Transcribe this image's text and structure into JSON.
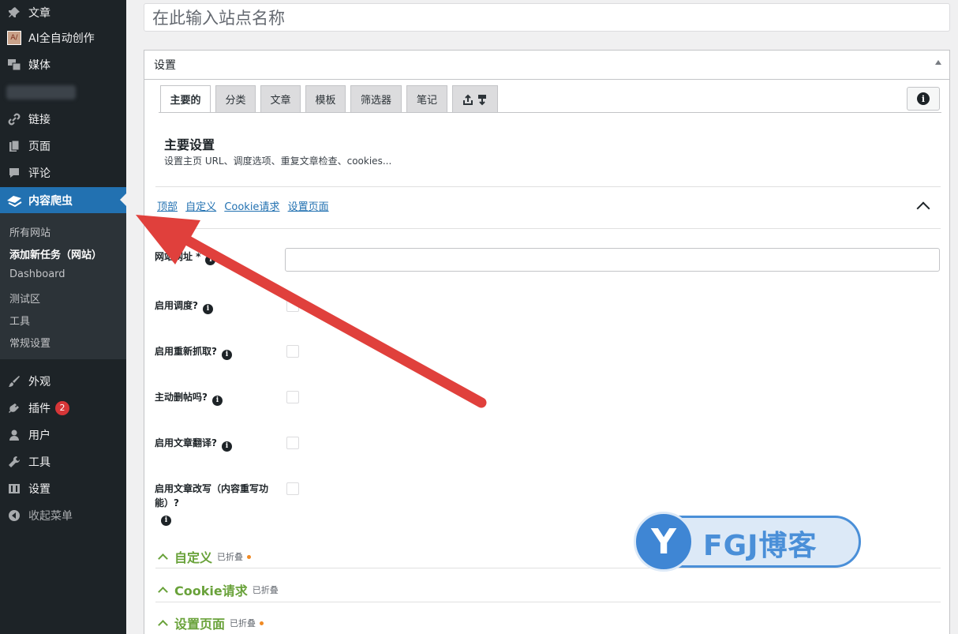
{
  "sidebar": {
    "items": [
      {
        "label": "文章",
        "icon": "pin-icon"
      },
      {
        "label": "AI全自动创作",
        "icon": "ai-logo-icon"
      },
      {
        "label": "媒体",
        "icon": "media-icon"
      },
      {
        "label": "链接",
        "icon": "link-icon"
      },
      {
        "label": "页面",
        "icon": "page-icon"
      },
      {
        "label": "评论",
        "icon": "comment-icon"
      },
      {
        "label": "内容爬虫",
        "icon": "crawler-icon"
      },
      {
        "label": "外观",
        "icon": "brush-icon"
      },
      {
        "label": "插件",
        "icon": "plugin-icon",
        "badge": "2"
      },
      {
        "label": "用户",
        "icon": "user-icon"
      },
      {
        "label": "工具",
        "icon": "wrench-icon"
      },
      {
        "label": "设置",
        "icon": "settings-icon"
      },
      {
        "label": "收起菜单",
        "icon": "collapse-icon"
      }
    ],
    "submenu": [
      "所有网站",
      "添加新任务（网站）",
      "Dashboard",
      "测试区",
      "工具",
      "常规设置"
    ],
    "ai_icon_text": "A/"
  },
  "title_placeholder": "在此输入站点名称",
  "settings": {
    "header": "设置",
    "tabs": [
      "主要的",
      "分类",
      "文章",
      "模板",
      "筛选器",
      "笔记"
    ],
    "section_title": "主要设置",
    "section_desc": "设置主页 URL、调度选项、重复文章检查、cookies...",
    "links": [
      "顶部",
      "自定义",
      "Cookie请求",
      "设置页面"
    ],
    "fields": [
      {
        "label": "网站网址 *"
      },
      {
        "label": "启用调度?"
      },
      {
        "label": "启用重新抓取?"
      },
      {
        "label": "主动删帖吗?"
      },
      {
        "label": "启用文章翻译?"
      },
      {
        "label_line1": "启用文章改写（内容重写功",
        "label_line2": "能）?"
      }
    ],
    "collapsed": [
      {
        "title": "自定义",
        "tag": "已折叠",
        "dot": true
      },
      {
        "title": "Cookie请求",
        "tag": "已折叠",
        "dot": false
      },
      {
        "title": "设置页面",
        "tag": "已折叠",
        "dot": true
      }
    ]
  },
  "watermark": {
    "letter": "Y",
    "text": "FGJ博客"
  },
  "colors": {
    "sidebar": "#1d2327",
    "active": "#2271b1",
    "accent_green": "#69a23a",
    "arrow": "#e0403c"
  }
}
